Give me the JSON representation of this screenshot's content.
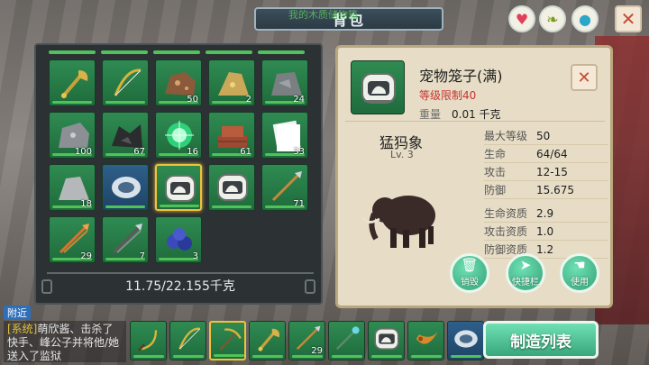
{
  "window": {
    "title": "背包",
    "ghost_text": "我的木质储物箱"
  },
  "top_buttons": {
    "close": "✕"
  },
  "inventory": {
    "slots": [
      {
        "kind": "axe",
        "count": ""
      },
      {
        "kind": "bow",
        "count": ""
      },
      {
        "kind": "ore-copper",
        "count": "50"
      },
      {
        "kind": "ore-gold",
        "count": "2"
      },
      {
        "kind": "ore-stone",
        "count": "24"
      },
      {
        "kind": "ore-iron",
        "count": "100"
      },
      {
        "kind": "coal",
        "count": "67"
      },
      {
        "kind": "orb",
        "count": "16"
      },
      {
        "kind": "bricks",
        "count": "61"
      },
      {
        "kind": "paper",
        "count": "33"
      },
      {
        "kind": "stone",
        "count": "18"
      },
      {
        "kind": "disc",
        "count": ""
      },
      {
        "kind": "pet-cage",
        "count": "",
        "selected": true
      },
      {
        "kind": "pet-cage",
        "count": ""
      },
      {
        "kind": "spear",
        "count": "71"
      },
      {
        "kind": "spear-fire",
        "count": "29"
      },
      {
        "kind": "spear-dark",
        "count": "7"
      },
      {
        "kind": "berries",
        "count": "3"
      }
    ],
    "weight": "11.75/22.155千克"
  },
  "detail": {
    "name": "宠物笼子(满)",
    "level_limit": "等级限制40",
    "weight_label": "重量",
    "weight_value": "0.01 千克",
    "close": "✕",
    "pet_name": "猛犸象",
    "pet_level": "Lv. 3",
    "stats": [
      {
        "label": "最大等级",
        "value": "50"
      },
      {
        "label": "生命",
        "value": "64/64"
      },
      {
        "label": "攻击",
        "value": "12-15"
      },
      {
        "label": "防御",
        "value": "15.675"
      }
    ],
    "aptitudes": [
      {
        "label": "生命资质",
        "value": "2.9"
      },
      {
        "label": "攻击资质",
        "value": "1.0"
      },
      {
        "label": "防御资质",
        "value": "1.2"
      }
    ],
    "actions": {
      "destroy": "销毁",
      "hotbar": "快捷栏",
      "use": "使用"
    }
  },
  "chat": {
    "tab": "附近",
    "prefix": "[系统]",
    "message": "萌欣酱、击杀了快手、峰公子并将他/她送入了监狱"
  },
  "hotbar": [
    {
      "kind": "sickle",
      "count": ""
    },
    {
      "kind": "bow",
      "count": ""
    },
    {
      "kind": "pickaxe",
      "count": "",
      "selected": true
    },
    {
      "kind": "axe",
      "count": ""
    },
    {
      "kind": "spear",
      "count": "29"
    },
    {
      "kind": "staff",
      "count": ""
    },
    {
      "kind": "pet-cage",
      "count": ""
    },
    {
      "kind": "horn",
      "count": ""
    },
    {
      "kind": "disc",
      "count": ""
    }
  ],
  "craft_button": "制造列表"
}
